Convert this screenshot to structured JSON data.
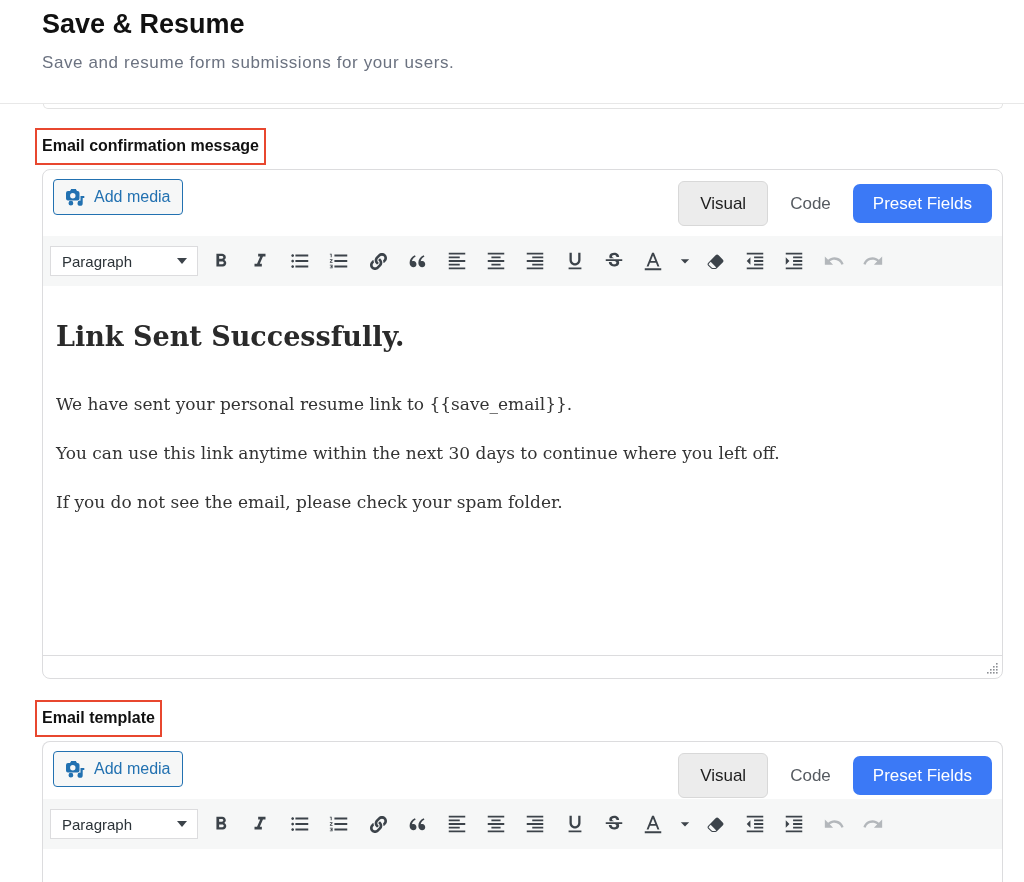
{
  "header": {
    "title": "Save & Resume",
    "subtitle": "Save and resume form submissions for your users."
  },
  "sections": [
    {
      "label": "Email confirmation message",
      "highlighted": true,
      "editor": {
        "add_media": "Add media",
        "tabs": [
          {
            "label": "Visual",
            "selected": true
          },
          {
            "label": "Code",
            "selected": false
          }
        ],
        "preset_button": "Preset Fields",
        "toolbar": {
          "format": "Paragraph",
          "items": [
            {
              "kind": "bold",
              "disabled": false
            },
            {
              "kind": "italic",
              "disabled": false
            },
            {
              "kind": "bullet_list",
              "disabled": false
            },
            {
              "kind": "numbered_list",
              "disabled": false
            },
            {
              "kind": "link",
              "disabled": false
            },
            {
              "kind": "blockquote",
              "disabled": false
            },
            {
              "kind": "align_left",
              "disabled": false
            },
            {
              "kind": "align_center",
              "disabled": false
            },
            {
              "kind": "align_right",
              "disabled": false
            },
            {
              "kind": "underline",
              "disabled": false
            },
            {
              "kind": "strikethrough",
              "disabled": false
            },
            {
              "kind": "text_color",
              "disabled": false
            },
            {
              "kind": "color_menu",
              "disabled": false
            },
            {
              "kind": "clear_formatting",
              "disabled": false
            },
            {
              "kind": "outdent",
              "disabled": false
            },
            {
              "kind": "indent",
              "disabled": false
            },
            {
              "kind": "undo",
              "disabled": true
            },
            {
              "kind": "redo",
              "disabled": true
            }
          ]
        },
        "content": [
          {
            "kind": "heading",
            "text": "Link Sent Successfully."
          },
          {
            "kind": "paragraph",
            "text": "We have sent your personal resume link to {{save_email}}."
          },
          {
            "kind": "paragraph",
            "text": "You can use this link anytime within the next 30 days to continue where you left off."
          },
          {
            "kind": "paragraph",
            "text": "If you do not see the email, please check your spam folder."
          }
        ]
      }
    },
    {
      "label": "Email template",
      "highlighted": true,
      "editor": {
        "add_media": "Add media",
        "tabs": [
          {
            "label": "Visual",
            "selected": true
          },
          {
            "label": "Code",
            "selected": false
          }
        ],
        "preset_button": "Preset Fields",
        "toolbar": {
          "format": "Paragraph",
          "items": [
            {
              "kind": "bold",
              "disabled": false
            },
            {
              "kind": "italic",
              "disabled": false
            },
            {
              "kind": "bullet_list",
              "disabled": false
            },
            {
              "kind": "numbered_list",
              "disabled": false
            },
            {
              "kind": "link",
              "disabled": false
            },
            {
              "kind": "blockquote",
              "disabled": false
            },
            {
              "kind": "align_left",
              "disabled": false
            },
            {
              "kind": "align_center",
              "disabled": false
            },
            {
              "kind": "align_right",
              "disabled": false
            },
            {
              "kind": "underline",
              "disabled": false
            },
            {
              "kind": "strikethrough",
              "disabled": false
            },
            {
              "kind": "text_color",
              "disabled": false
            },
            {
              "kind": "color_menu",
              "disabled": false
            },
            {
              "kind": "clear_formatting",
              "disabled": false
            },
            {
              "kind": "outdent",
              "disabled": false
            },
            {
              "kind": "indent",
              "disabled": false
            },
            {
              "kind": "undo",
              "disabled": true
            },
            {
              "kind": "redo",
              "disabled": true
            }
          ]
        }
      }
    }
  ]
}
